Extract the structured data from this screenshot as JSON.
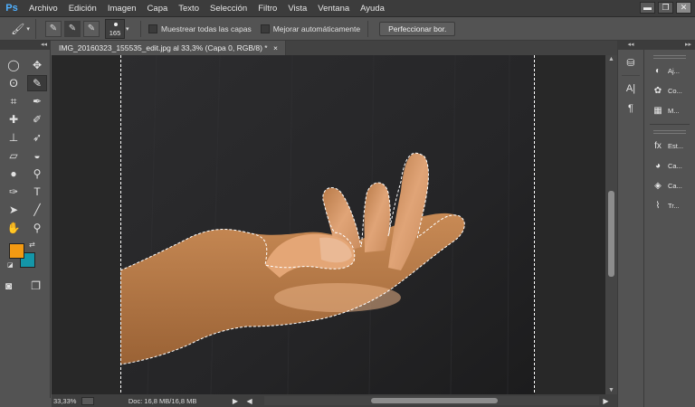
{
  "app": {
    "logo": "Ps"
  },
  "menu": [
    "Archivo",
    "Edición",
    "Imagen",
    "Capa",
    "Texto",
    "Selección",
    "Filtro",
    "Vista",
    "Ventana",
    "Ayuda"
  ],
  "window_controls": {
    "minimize": "▬",
    "restore": "❐",
    "close": "✕"
  },
  "options": {
    "tool_icon": "quick-selection-icon",
    "brush_size": "165",
    "sample_all_layers": "Muestrear todas las capas",
    "auto_enhance": "Mejorar automáticamente",
    "refine_edge": "Perfeccionar bor."
  },
  "document": {
    "tab_title": "IMG_20160323_155535_edit.jpg al 33,3% (Capa 0, RGB/8) *",
    "tab_close": "×"
  },
  "status": {
    "zoom": "33,33%",
    "doc_size": "Doc: 16,8 MB/16,8 MB",
    "arrow": "▶",
    "left_arrow": "◀",
    "right_arrow": "▶"
  },
  "colors": {
    "foreground": "#f39a12",
    "background": "#1496a8",
    "accent": "#4fb0ff"
  },
  "right_panel": {
    "items": [
      {
        "icon": "◐",
        "label": "Aj..."
      },
      {
        "icon": "✿",
        "label": "Co..."
      },
      {
        "icon": "▦",
        "label": "M..."
      },
      {
        "icon": "fx",
        "label": "Est..."
      },
      {
        "icon": "◕",
        "label": "Ca..."
      },
      {
        "icon": "◈",
        "label": "Ca..."
      },
      {
        "icon": "⌇",
        "label": "Tr..."
      }
    ]
  },
  "mini_panel": {
    "history": "⛁",
    "character": "A|",
    "paragraph": "¶"
  }
}
